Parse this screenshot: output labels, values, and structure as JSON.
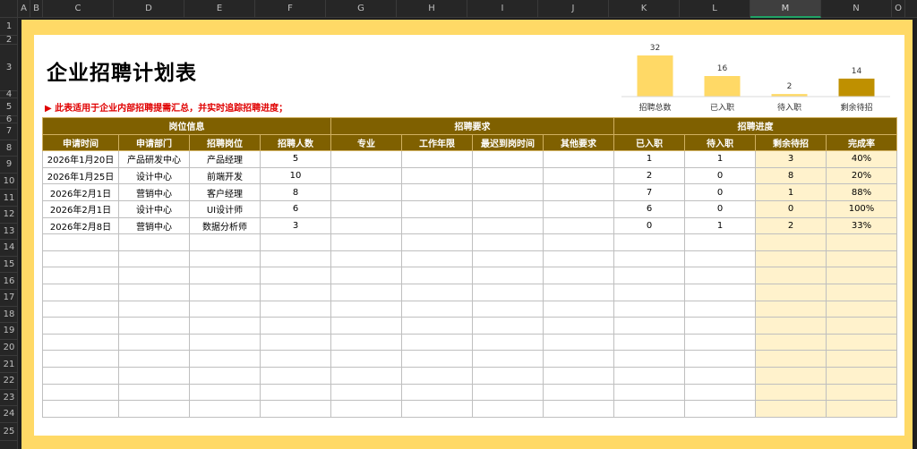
{
  "columns": [
    "A",
    "B",
    "C",
    "D",
    "E",
    "F",
    "G",
    "H",
    "I",
    "J",
    "K",
    "L",
    "M",
    "N",
    "O"
  ],
  "selected_column": "M",
  "rows": [
    "1",
    "2",
    "3",
    "4",
    "5",
    "6",
    "7",
    "8",
    "9",
    "10",
    "11",
    "12",
    "13",
    "14",
    "15",
    "16",
    "17",
    "18",
    "19",
    "20",
    "21",
    "22",
    "23",
    "24",
    "25"
  ],
  "title": "企业招聘计划表",
  "note": "▶ 此表适用于企业内部招聘提需汇总，并实时追踪招聘进度；",
  "colors": {
    "frame": "#ffd966",
    "header": "#7f6000",
    "highlight": "#fff2cc",
    "bar_light": "#ffd966",
    "bar_dark": "#bf9000"
  },
  "chart_data": {
    "type": "bar",
    "categories": [
      "招聘总数",
      "已入职",
      "待入职",
      "剩余待招"
    ],
    "values": [
      32,
      16,
      2,
      14
    ],
    "colors": [
      "#ffd966",
      "#ffd966",
      "#ffd966",
      "#bf9000"
    ],
    "ylim": [
      0,
      32
    ]
  },
  "table": {
    "groups": [
      "岗位信息",
      "招聘要求",
      "招聘进度"
    ],
    "headers": [
      "申请时间",
      "申请部门",
      "招聘岗位",
      "招聘人数",
      "专业",
      "工作年限",
      "最迟到岗时间",
      "其他要求",
      "已入职",
      "待入职",
      "剩余待招",
      "完成率"
    ],
    "rows": [
      [
        "2026年1月20日",
        "产品研发中心",
        "产品经理",
        "5",
        "",
        "",
        "",
        "",
        "1",
        "1",
        "3",
        "40%"
      ],
      [
        "2026年1月25日",
        "设计中心",
        "前端开发",
        "10",
        "",
        "",
        "",
        "",
        "2",
        "0",
        "8",
        "20%"
      ],
      [
        "2026年2月1日",
        "营销中心",
        "客户经理",
        "8",
        "",
        "",
        "",
        "",
        "7",
        "0",
        "1",
        "88%"
      ],
      [
        "2026年2月1日",
        "设计中心",
        "UI设计师",
        "6",
        "",
        "",
        "",
        "",
        "6",
        "0",
        "0",
        "100%"
      ],
      [
        "2026年2月8日",
        "营销中心",
        "数据分析师",
        "3",
        "",
        "",
        "",
        "",
        "0",
        "1",
        "2",
        "33%"
      ]
    ],
    "empty_rows": 11
  }
}
